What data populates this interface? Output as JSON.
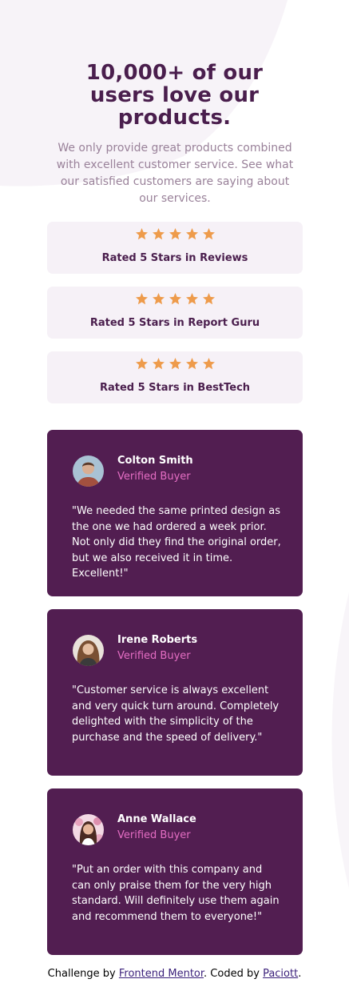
{
  "hero": {
    "title_line1": "10,000+ of our",
    "title_line2": "users love our",
    "title_line3": "products.",
    "description": "We only provide great products combined with excellent customer service. See what our satisfied customers are saying about our services."
  },
  "ratings": [
    {
      "label": "Rated 5 Stars in Reviews",
      "stars": 5
    },
    {
      "label": "Rated 5 Stars in Report Guru",
      "stars": 5
    },
    {
      "label": "Rated 5 Stars in BestTech",
      "stars": 5
    }
  ],
  "testimonials": [
    {
      "name": "Colton Smith",
      "status": "Verified Buyer",
      "quote": "\"We needed the same printed design as the one we had ordered a week prior. Not only did they find the original order, but we also received it in time. Excellent!\""
    },
    {
      "name": "Irene Roberts",
      "status": "Verified Buyer",
      "quote": "\"Customer service is always excellent and very quick turn around. Completely delighted with the simplicity of the purchase and the speed of delivery.\""
    },
    {
      "name": "Anne Wallace",
      "status": "Verified Buyer",
      "quote": "\"Put an order with this company and can only praise them for the very high standard. Will definitely use them again and recommend them to everyone!\""
    }
  ],
  "footer": {
    "prefix": "Challenge by ",
    "link1": "Frontend Mentor",
    "middle": ". Coded by ",
    "link2": "Paciott",
    "suffix": "."
  },
  "colors": {
    "accent": "#4a1e4d",
    "card_bg": "#521e51",
    "star": "#ee9b4b",
    "verified": "#e46dc3",
    "rating_bg": "#f6f1f7"
  },
  "icons": {
    "star": "star-icon"
  }
}
